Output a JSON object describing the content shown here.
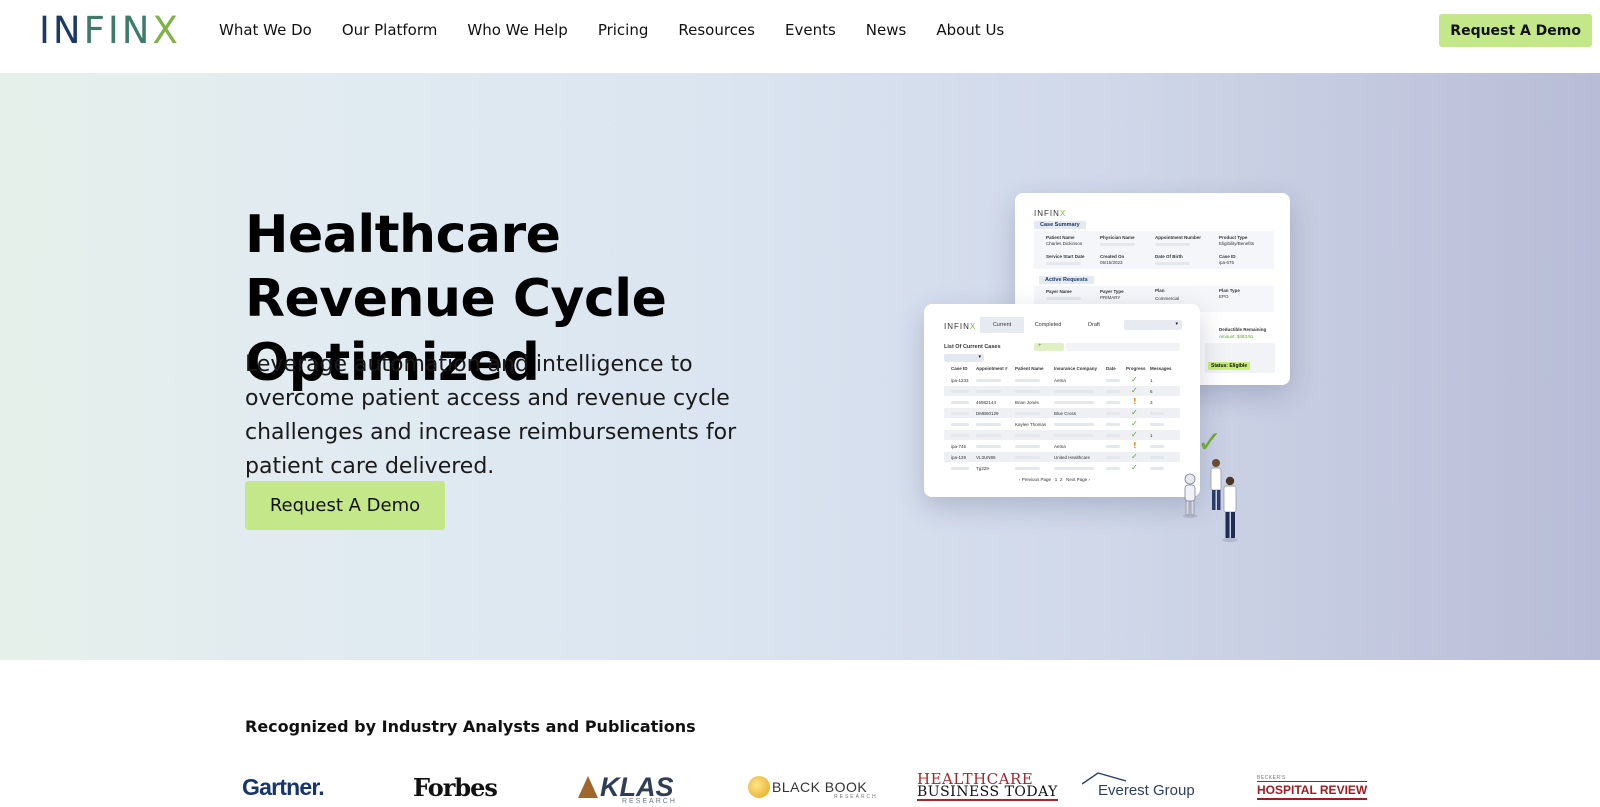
{
  "header": {
    "logo": {
      "part1": "IN",
      "part2": "FIN",
      "part3": "X"
    },
    "nav": [
      "What We Do",
      "Our Platform",
      "Who We Help",
      "Pricing",
      "Resources",
      "Events",
      "News",
      "About Us"
    ],
    "cta_label": "Request A Demo"
  },
  "hero": {
    "title": "Healthcare Revenue Cycle Optimized",
    "subtitle": "Leverage automation and intelligence to overcome patient access and revenue cycle challenges and increase reimbursements for patient care delivered.",
    "cta_label": "Request A Demo"
  },
  "illustration": {
    "back_card": {
      "logo": {
        "a": "INFIN",
        "b": "X"
      },
      "case_summary_label": "Case Summary",
      "fields": [
        {
          "label": "Patient Name",
          "value": "Charles Dickinson"
        },
        {
          "label": "Physician Name",
          "value": ""
        },
        {
          "label": "Appointment Number",
          "value": ""
        },
        {
          "label": "Product Type",
          "value": "Eligibility/Benefits"
        },
        {
          "label": "Service Start Date",
          "value": ""
        },
        {
          "label": "Created On",
          "value": "05/15/2023"
        },
        {
          "label": "Date Of Birth",
          "value": ""
        },
        {
          "label": "Case ID",
          "value": "ipa-675"
        }
      ],
      "active_requests_label": "Active Requests",
      "request_fields": [
        {
          "label": "Payer Name",
          "value": ""
        },
        {
          "label": "Payer Type",
          "value": "PRIMARY"
        },
        {
          "label": "Plan",
          "value": "Commercial"
        },
        {
          "label": "Plan Type",
          "value": "EPO"
        }
      ],
      "deductible_label": "Deductible Remaining",
      "deductible_value": "Amount: $483.91",
      "status_chip": "Status: Eligible"
    },
    "front_card": {
      "logo": {
        "a": "INFIN",
        "b": "X"
      },
      "tabs": [
        "Current",
        "Completed",
        "Draft"
      ],
      "list_title": "List Of Current Cases",
      "columns": [
        "Case ID",
        "Appointment #",
        "Patient Name",
        "Insurance Company",
        "Date",
        "Progress",
        "Messages"
      ],
      "rows": [
        {
          "case_id": "ipa-1233",
          "appt": "",
          "patient": "",
          "insurer": "Aetna",
          "progress": "check",
          "messages": "1"
        },
        {
          "case_id": "",
          "appt": "",
          "patient": "",
          "insurer": "",
          "progress": "check",
          "messages": "6"
        },
        {
          "case_id": "",
          "appt": "46982144",
          "patient": "Brian Jones",
          "insurer": "",
          "progress": "alert",
          "messages": "3"
        },
        {
          "case_id": "",
          "appt": "DMB90129",
          "patient": "",
          "insurer": "Blue Cross",
          "progress": "check",
          "messages": ""
        },
        {
          "case_id": "",
          "appt": "",
          "patient": "Kaylee Thomas",
          "insurer": "",
          "progress": "check",
          "messages": ""
        },
        {
          "case_id": "",
          "appt": "",
          "patient": "",
          "insurer": "",
          "progress": "check",
          "messages": "1"
        },
        {
          "case_id": "ipa-745",
          "appt": "",
          "patient": "",
          "insurer": "Aetna",
          "progress": "alert",
          "messages": ""
        },
        {
          "case_id": "ipa-129",
          "appt": "VL3UN95",
          "patient": "",
          "insurer": "United Healthcare",
          "progress": "check",
          "messages": ""
        },
        {
          "case_id": "",
          "appt": "Tg329",
          "patient": "",
          "insurer": "",
          "progress": "check",
          "messages": ""
        }
      ],
      "pagination": {
        "prev": "Previous Page",
        "pages": [
          "1",
          "2"
        ],
        "next": "Next Page"
      }
    }
  },
  "recognition": {
    "title": "Recognized by Industry Analysts and Publications",
    "gartner": "Gartner.",
    "forbes": "Forbes",
    "klas": "KLAS",
    "klas_sub": "RESEARCH",
    "blackbook": "BLACK BOOK",
    "blackbook_sub": "RESEARCH",
    "hbt_line1": "HEALTHCARE",
    "hbt_line2": "BUSINESS TODAY",
    "everest": "Everest Group",
    "beckers_top": "BECKER'S",
    "beckers_main": "HOSPITAL REVIEW"
  },
  "colors": {
    "brand_navy": "#1c3966",
    "brand_green": "#7cb342",
    "cta_green": "#c4e78a"
  }
}
